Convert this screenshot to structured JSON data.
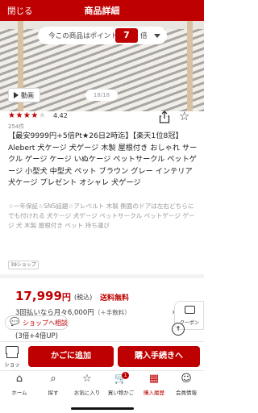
{
  "header": {
    "close_label": "閉じる",
    "title": "商品詳細"
  },
  "points_banner": {
    "text": "今この商品はポイント",
    "multiplier": "7",
    "suffix": "倍"
  },
  "media": {
    "video_label": "動画",
    "counter": "18/18"
  },
  "rating": {
    "stars": "★★★★",
    "half_star": "★",
    "score": "4.42",
    "review_count": "254件"
  },
  "product": {
    "title": "【最安9999円+5倍Pt★26日2時迄】【楽天1位8冠】Alebert 犬ケージ 犬ゲージ 木製 屋根付き おしゃれ サークル ゲージ ケージ いぬケージ ペットサークル ペットゲージ 小型犬 中型犬 ペット ブラウン グレー インテリア 犬ケージ プレゼント オシャレ 犬ゲージ",
    "catch_copy": "☆一年保証☆SNS話題☆アレベルト 木製 側面のドアは左右どちらにでも付けれる 犬ケージ 犬ゲージ ペットサークル ペットゲージ ゲージ 犬 木製 屋根付き ペット 持ち運び",
    "shop_badge": "39ショップ"
  },
  "pricing": {
    "price": "17,999",
    "currency": "円",
    "tax_label": "(税込)",
    "shipping": "送料無料",
    "installment": "3回払いなら月々6,000円",
    "installment_fee": "（＋手数料）",
    "points_note": "(3倍+4倍UP)"
  },
  "side_widgets": {
    "coupon_label": "クーポン",
    "consult_label": "ショップへ相談"
  },
  "actions": {
    "shop_label": "ショップ",
    "add_to_cart": "かごに追加",
    "buy": "購入手続きへ"
  },
  "tabbar": {
    "items": [
      {
        "label": "ホーム",
        "icon": "⌂"
      },
      {
        "label": "探す",
        "icon": "⌕"
      },
      {
        "label": "お気に入り",
        "icon": "☆"
      },
      {
        "label": "買い物かご",
        "icon": "🛒",
        "badge": "1"
      },
      {
        "label": "購入履歴",
        "icon": "▦"
      },
      {
        "label": "会員情報",
        "icon": "☺"
      }
    ]
  },
  "colors": {
    "brand": "#bf0000",
    "text": "#333333",
    "muted": "#999999"
  }
}
